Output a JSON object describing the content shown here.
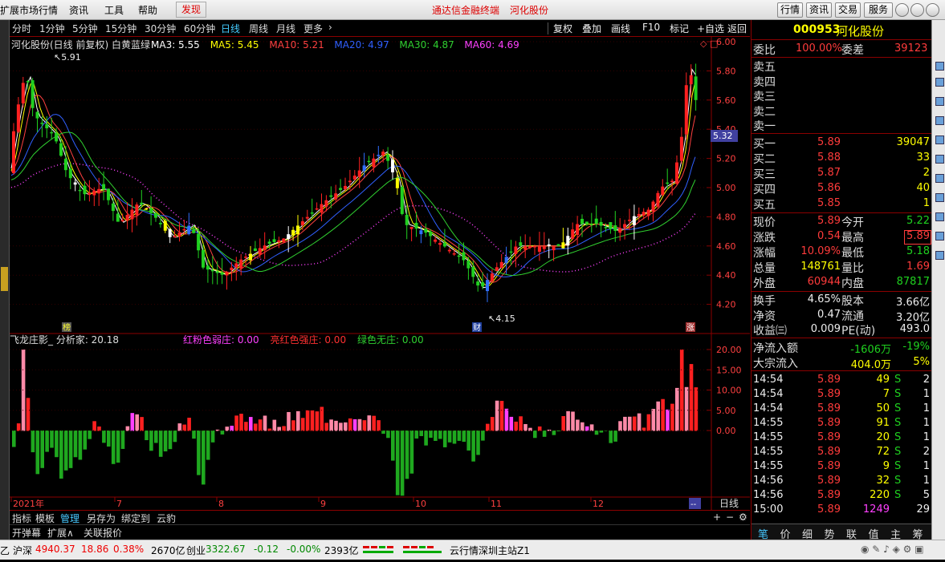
{
  "menubar": {
    "items": [
      "扩展市场行情",
      "资讯",
      "工具",
      "帮助"
    ],
    "discover": "发现",
    "center_links": [
      "通达信金融终端",
      "河化股份"
    ],
    "right_buttons": [
      "行情",
      "资讯",
      "交易",
      "服务"
    ]
  },
  "periods": [
    "分时",
    "1分钟",
    "5分钟",
    "15分钟",
    "30分钟",
    "60分钟",
    "日线",
    "周线",
    "月线",
    "更多"
  ],
  "active_period": "日线",
  "tools": [
    "复权",
    "叠加",
    "画线",
    "F10",
    "标记",
    "+自选",
    "返回"
  ],
  "main_chart": {
    "header": "河化股份(日线 前复权) 白黄蓝绿",
    "ma": [
      {
        "label": "MA3: 5.55",
        "color": "#ffffff"
      },
      {
        "label": "MA5: 5.45",
        "color": "#ffff00"
      },
      {
        "label": "MA10: 5.21",
        "color": "#ff4040"
      },
      {
        "label": "MA20: 4.97",
        "color": "#3060ff"
      },
      {
        "label": "MA30: 4.87",
        "color": "#30d030"
      },
      {
        "label": "MA60: 4.69",
        "color": "#ff40ff"
      }
    ],
    "y_ticks": [
      "6.00",
      "5.80",
      "5.60",
      "5.40",
      "5.20",
      "5.00",
      "4.80",
      "4.60",
      "4.40",
      "4.20"
    ],
    "current_price_tag": "5.32",
    "high_annotation": "5.91",
    "low_annotation": "4.15",
    "markers": [
      "榜",
      "财",
      "涨"
    ]
  },
  "sub_chart": {
    "name": "飞龙庄影_ 分析家: 20.18",
    "legend": [
      {
        "label": "红粉色弱庄: 0.00",
        "color": "#ff40ff"
      },
      {
        "label": "亮红色强庄: 0.00",
        "color": "#ff3030"
      },
      {
        "label": "绿色无庄: 0.00",
        "color": "#30d030"
      }
    ],
    "y_ticks": [
      "20.00",
      "15.00",
      "10.00",
      "5.00",
      "0.00"
    ]
  },
  "x_axis": {
    "labels": [
      "2021年",
      "7",
      "8",
      "9",
      "10",
      "11",
      "12"
    ],
    "end_tag": "--",
    "period_label": "日线"
  },
  "bottom_toolbar_1": [
    "指标",
    "模板",
    "管理",
    "另存为",
    "绑定到",
    "云豹"
  ],
  "bottom_toolbar_2": [
    "开弹幕",
    "扩展∧",
    "关联报价"
  ],
  "quote": {
    "code": "000953",
    "name": "河化股份",
    "weibi_label": "委比",
    "weibi": "100.00%",
    "weicha_label": "委差",
    "weicha": "39123",
    "asks": [
      {
        "label": "卖五",
        "price": "",
        "vol": ""
      },
      {
        "label": "卖四",
        "price": "",
        "vol": ""
      },
      {
        "label": "卖三",
        "price": "",
        "vol": ""
      },
      {
        "label": "卖二",
        "price": "",
        "vol": ""
      },
      {
        "label": "卖一",
        "price": "",
        "vol": ""
      }
    ],
    "bids": [
      {
        "label": "买一",
        "price": "5.89",
        "vol": "39047"
      },
      {
        "label": "买二",
        "price": "5.88",
        "vol": "33"
      },
      {
        "label": "买三",
        "price": "5.87",
        "vol": "2"
      },
      {
        "label": "买四",
        "price": "5.86",
        "vol": "40"
      },
      {
        "label": "买五",
        "price": "5.85",
        "vol": "1"
      }
    ],
    "stats": [
      {
        "l1": "现价",
        "v1": "5.89",
        "c1": "red",
        "l2": "今开",
        "v2": "5.22",
        "c2": "grn"
      },
      {
        "l1": "涨跌",
        "v1": "0.54",
        "c1": "red",
        "l2": "最高",
        "v2": "5.89",
        "c2": "red"
      },
      {
        "l1": "涨幅",
        "v1": "10.09%",
        "c1": "red",
        "l2": "最低",
        "v2": "5.18",
        "c2": "grn"
      },
      {
        "l1": "总量",
        "v1": "148761",
        "c1": "yel",
        "l2": "量比",
        "v2": "1.69",
        "c2": "red"
      },
      {
        "l1": "外盘",
        "v1": "60944",
        "c1": "red",
        "l2": "内盘",
        "v2": "87817",
        "c2": "grn"
      }
    ],
    "fund": [
      {
        "l1": "换手",
        "v1": "4.65%",
        "l2": "股本",
        "v2": "3.66亿"
      },
      {
        "l1": "净资",
        "v1": "0.47",
        "l2": "流通",
        "v2": "3.20亿"
      },
      {
        "l1": "收益㈢",
        "v1": "0.009",
        "l2": "PE(动)",
        "v2": "493.0"
      }
    ],
    "flow": [
      {
        "label": "净流入额",
        "v1": "-1606万",
        "v2": "-19%",
        "color": "grn"
      },
      {
        "label": "大宗流入",
        "v1": "404.0万",
        "v2": "5%",
        "color": "yel"
      }
    ],
    "ticks": [
      {
        "time": "14:54",
        "price": "5.89",
        "vol": "49",
        "side": "S",
        "n": "2"
      },
      {
        "time": "14:54",
        "price": "5.89",
        "vol": "7",
        "side": "S",
        "n": "1"
      },
      {
        "time": "14:54",
        "price": "5.89",
        "vol": "50",
        "side": "S",
        "n": "1"
      },
      {
        "time": "14:55",
        "price": "5.89",
        "vol": "91",
        "side": "S",
        "n": "1"
      },
      {
        "time": "14:55",
        "price": "5.89",
        "vol": "20",
        "side": "S",
        "n": "1"
      },
      {
        "time": "14:55",
        "price": "5.89",
        "vol": "72",
        "side": "S",
        "n": "2"
      },
      {
        "time": "14:55",
        "price": "5.89",
        "vol": "9",
        "side": "S",
        "n": "1"
      },
      {
        "time": "14:56",
        "price": "5.89",
        "vol": "32",
        "side": "S",
        "n": "1"
      },
      {
        "time": "14:56",
        "price": "5.89",
        "vol": "220",
        "side": "S",
        "n": "5"
      },
      {
        "time": "15:00",
        "price": "5.89",
        "vol": "1249",
        "side": "",
        "n": "29"
      }
    ],
    "tabs": [
      "笔",
      "价",
      "细",
      "势",
      "联",
      "值",
      "主",
      "筹"
    ]
  },
  "status": {
    "sh_label": "沪深",
    "sh_value": "4940.37",
    "sh_change": "18.86",
    "sh_pct": "0.38%",
    "sh_amount": "2670亿",
    "cy_label": "创业",
    "cy_value": "3322.67",
    "cy_change": "-0.12",
    "cy_pct": "-0.00%",
    "cy_amount": "2393亿",
    "server": "云行情深圳主站Z1",
    "left_cut": "乙"
  }
}
